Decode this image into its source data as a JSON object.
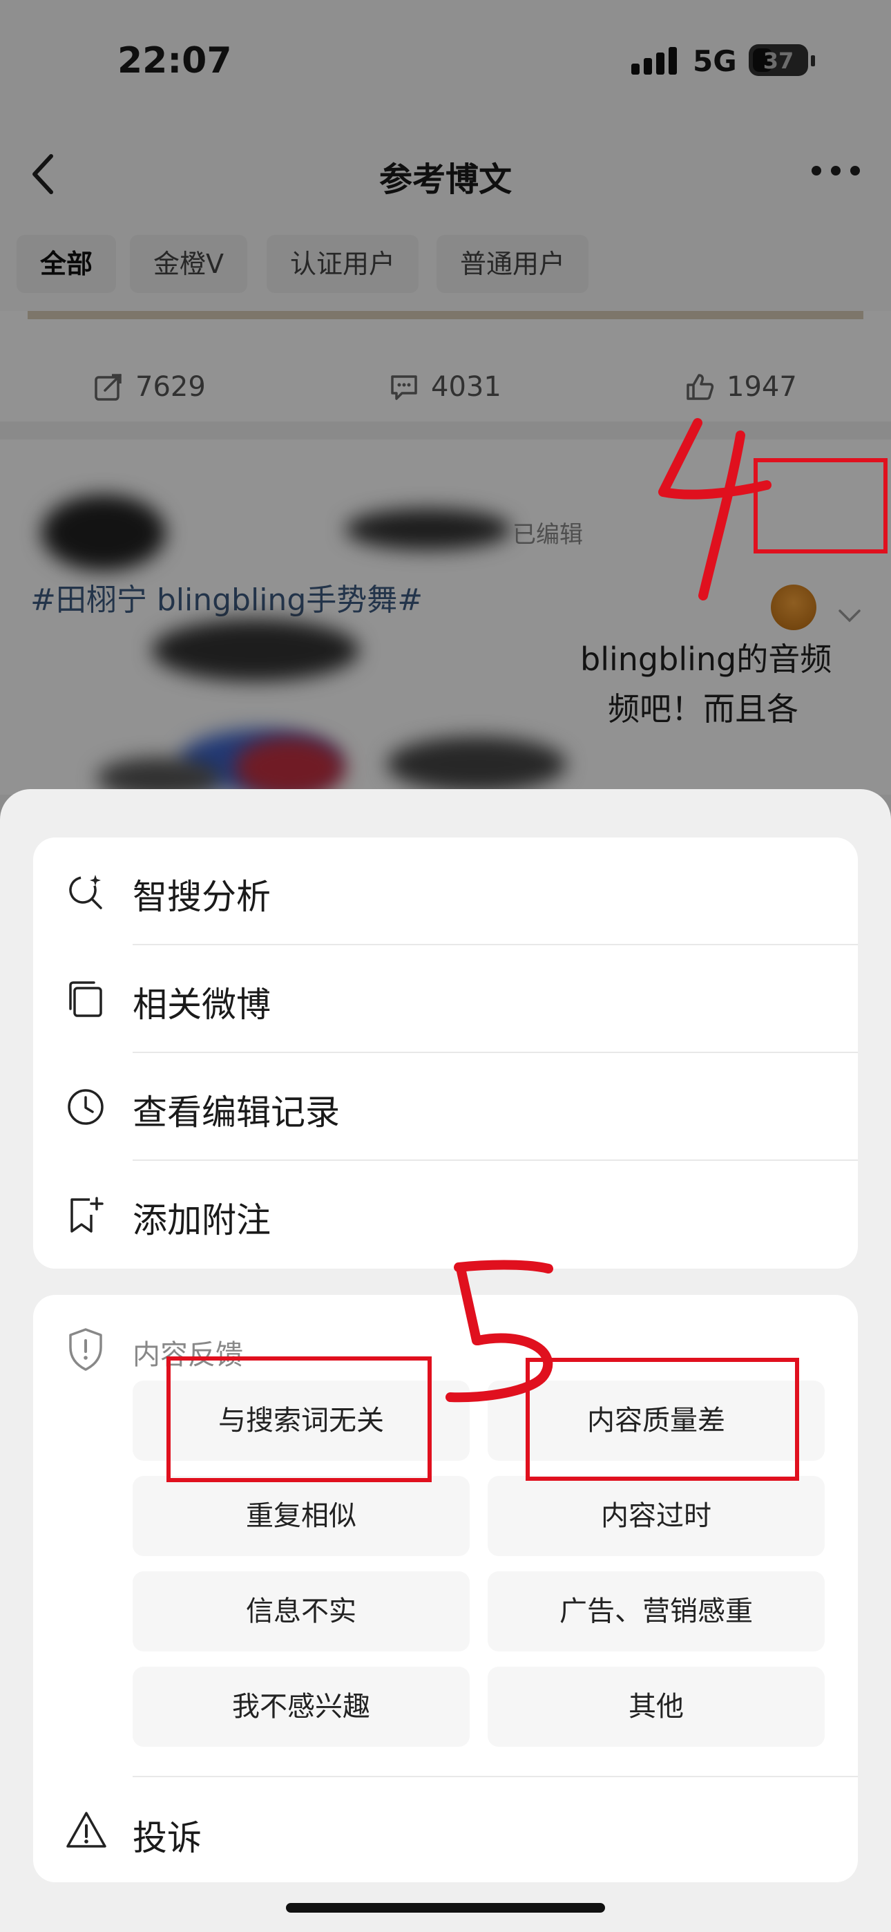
{
  "status_bar": {
    "time": "22:07",
    "network": "5G",
    "battery": "37"
  },
  "nav": {
    "title": "参考博文",
    "back_icon": "chevron-left-icon",
    "more_icon": "ellipsis-icon"
  },
  "filters": [
    {
      "label": "全部",
      "active": true
    },
    {
      "label": "金橙V",
      "active": false
    },
    {
      "label": "认证用户",
      "active": false
    },
    {
      "label": "普通用户",
      "active": false
    }
  ],
  "post_actions": {
    "reposts": "7629",
    "comments": "4031",
    "likes": "1947"
  },
  "post": {
    "edited_label": "已编辑",
    "topic": "#田栩宁 blingbling手势舞#",
    "line1_visible": "blingbling的音频",
    "line2_visible": "频吧！而且各"
  },
  "annotations": {
    "step4": "4",
    "step5": "5",
    "color": "#e0101e"
  },
  "menu": [
    {
      "label": "智搜分析",
      "icon": "ai-search-icon"
    },
    {
      "label": "相关微博",
      "icon": "related-posts-icon"
    },
    {
      "label": "查看编辑记录",
      "icon": "clock-icon"
    },
    {
      "label": "添加附注",
      "icon": "add-note-icon"
    }
  ],
  "feedback": {
    "title": "内容反馈",
    "icon": "shield-alert-icon",
    "options": [
      "与搜索词无关",
      "内容质量差",
      "重复相似",
      "内容过时",
      "信息不实",
      "广告、营销感重",
      "我不感兴趣",
      "其他"
    ]
  },
  "report": {
    "label": "投诉",
    "icon": "warning-icon"
  }
}
